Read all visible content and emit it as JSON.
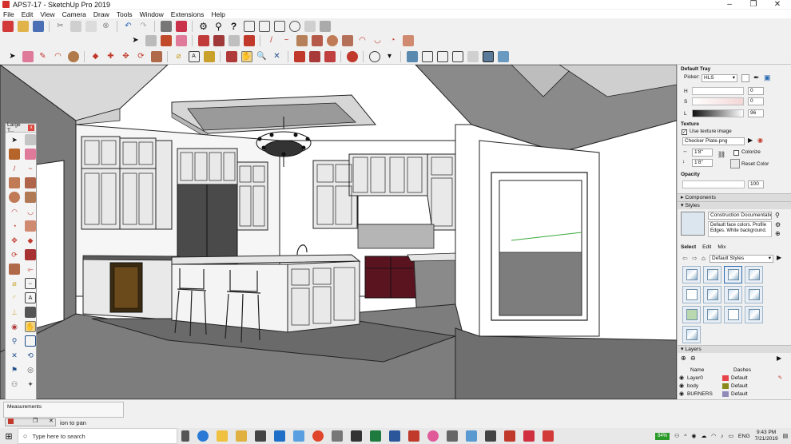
{
  "window": {
    "title": "APS7-17 - SketchUp Pro 2019",
    "minimize": "–",
    "maximize": "❐",
    "close": "✕"
  },
  "menu": [
    "File",
    "Edit",
    "View",
    "Camera",
    "Draw",
    "Tools",
    "Window",
    "Extensions",
    "Help"
  ],
  "tool_palette": {
    "title": "Large T...",
    "close": "x"
  },
  "tray": {
    "title": "Default Tray",
    "picker_label": "Picker:",
    "picker_value": "HLS",
    "h_label": "H",
    "s_label": "S",
    "l_label": "L",
    "h_value": "0",
    "s_value": "0",
    "l_value": "96",
    "texture_heading": "Texture",
    "use_texture_label": "Use texture image",
    "texture_file": "Checker Plate.png",
    "tex_width": "1'8\"",
    "tex_height": "1'8\"",
    "colorize_label": "Colorize",
    "reset_color_label": "Reset Color",
    "opacity_heading": "Opacity",
    "opacity_value": "100",
    "components_heading": "Components",
    "styles_heading": "Styles",
    "style_name": "Construction Documentation St",
    "style_description": "Default face colors. Profile Edges. White background.",
    "style_tabs": [
      "Select",
      "Edit",
      "Mix"
    ],
    "style_collection": "Default Styles",
    "layers_heading": "Layers",
    "layer_col_name": "Name",
    "layer_col_dashes": "Dashes",
    "layers": [
      {
        "name": "Layer0",
        "dashes": "Default",
        "color": "#e8454a"
      },
      {
        "name": "body",
        "dashes": "Default",
        "color": "#8a8a1c"
      },
      {
        "name": "BURNERS",
        "dashes": "Default",
        "color": "#8f8ab8"
      }
    ]
  },
  "status": {
    "measurements_label": "Measurements",
    "hint": "ion to pan"
  },
  "taskbar": {
    "search_placeholder": "Type here to search",
    "battery": "84%",
    "language": "ENG",
    "time": "9:43 PM",
    "date": "7/21/2019"
  }
}
